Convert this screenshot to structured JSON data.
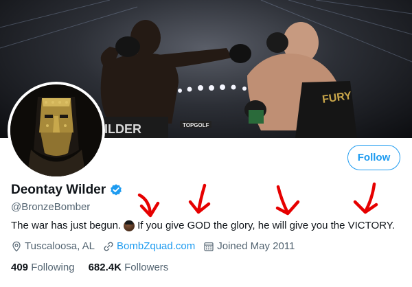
{
  "profile": {
    "display_name": "Deontay Wilder",
    "handle": "@BronzeBomber",
    "bio_part1": "The war has just begun.",
    "bio_part2": "If you give GOD the glory, he will give you the VICTORY.",
    "location": "Tuscaloosa, AL",
    "website": "BombZquad.com",
    "joined": "Joined May 2011",
    "following_count": "409",
    "following_label": "Following",
    "followers_count": "682.4K",
    "followers_label": "Followers"
  },
  "actions": {
    "follow_label": "Follow"
  },
  "banner": {
    "trunk_left_text": "ILDER",
    "trunk_right_text": "FURY",
    "sponsor_text": "TOPGOLF"
  },
  "colors": {
    "accent": "#1d9bf0",
    "annotation": "#e60000",
    "muted": "#536471"
  },
  "icons": {
    "verified": "verified-badge-icon",
    "location": "location-pin-icon",
    "link": "link-icon",
    "calendar": "calendar-icon",
    "emoji": "boxer-emoji-icon"
  }
}
